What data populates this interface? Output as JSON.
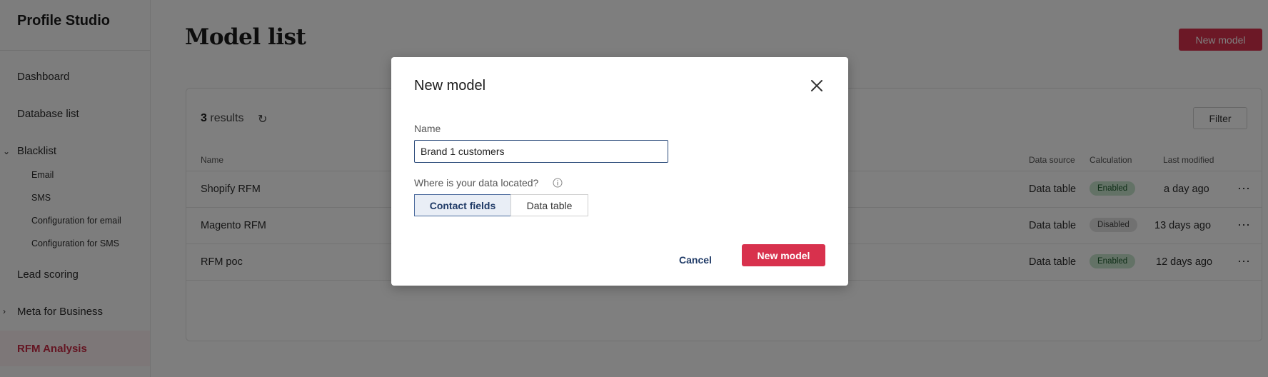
{
  "sidebar": {
    "brand": "Profile Studio",
    "items": [
      {
        "label": "Dashboard"
      },
      {
        "label": "Database list"
      },
      {
        "label": "Blacklist",
        "expanded": true,
        "children": [
          {
            "label": "Email"
          },
          {
            "label": "SMS"
          },
          {
            "label": "Configuration for email"
          },
          {
            "label": "Configuration for SMS"
          }
        ]
      },
      {
        "label": "Lead scoring"
      },
      {
        "label": "Meta for Business",
        "expanded": false
      },
      {
        "label": "RFM Analysis",
        "active": true
      }
    ]
  },
  "main": {
    "title": "Model list",
    "new_button": "New model",
    "results_count": "3",
    "results_label": "results",
    "filter_button": "Filter",
    "table": {
      "columns": [
        "Name",
        "Data source",
        "Calculation",
        "Last modified"
      ],
      "rows": [
        {
          "name": "Shopify RFM",
          "data_source": "Data table",
          "calculation": "Enabled",
          "last_modified": "a day ago"
        },
        {
          "name": "Magento RFM",
          "data_source": "Data table",
          "calculation": "Disabled",
          "last_modified": "13 days ago"
        },
        {
          "name": "RFM poc",
          "data_source": "Data table",
          "calculation": "Enabled",
          "last_modified": "12 days ago"
        }
      ]
    }
  },
  "modal": {
    "title": "New model",
    "name_label": "Name",
    "name_value": "Brand 1 customers",
    "location_label": "Where is your data located?",
    "options": [
      "Contact fields",
      "Data table"
    ],
    "selected_option": "Contact fields",
    "cancel_label": "Cancel",
    "submit_label": "New model"
  },
  "colors": {
    "accent": "#d8314d",
    "primary_text": "#1f3a66",
    "enabled_badge": "#c6e4cd",
    "disabled_badge": "#e3e3e3"
  }
}
